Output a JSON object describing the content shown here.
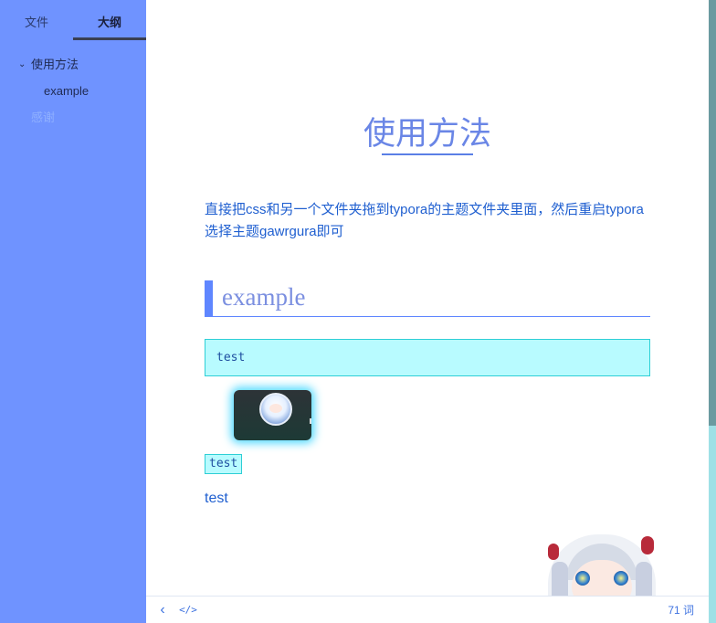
{
  "sidebar": {
    "tabs": [
      {
        "label": "文件"
      },
      {
        "label": "大纲"
      }
    ],
    "outline": [
      {
        "label": "使用方法"
      },
      {
        "label": "example"
      },
      {
        "label": "感谢"
      }
    ],
    "colors": {
      "background": "#6f93ff",
      "active_underline": "#3a3f52"
    }
  },
  "document": {
    "title": "使用方法",
    "paragraph": "直接把css和另一个文件夹拖到typora的主题文件夹里面，然后重启typora选择主题gawrgura即可",
    "heading2": "example",
    "code_block": "test",
    "inline_code": "test",
    "plain_text": "test",
    "colors": {
      "accent": "#5f86ff",
      "code_bg": "#b8fbff",
      "code_border": "#2ecfd6",
      "text": "#1f5fd0"
    }
  },
  "footer": {
    "back_icon": "chevron-left-icon",
    "source_icon": "code-icon",
    "word_count": "71 词"
  },
  "icons": {
    "outline_toggle": "chevron-down-icon"
  }
}
